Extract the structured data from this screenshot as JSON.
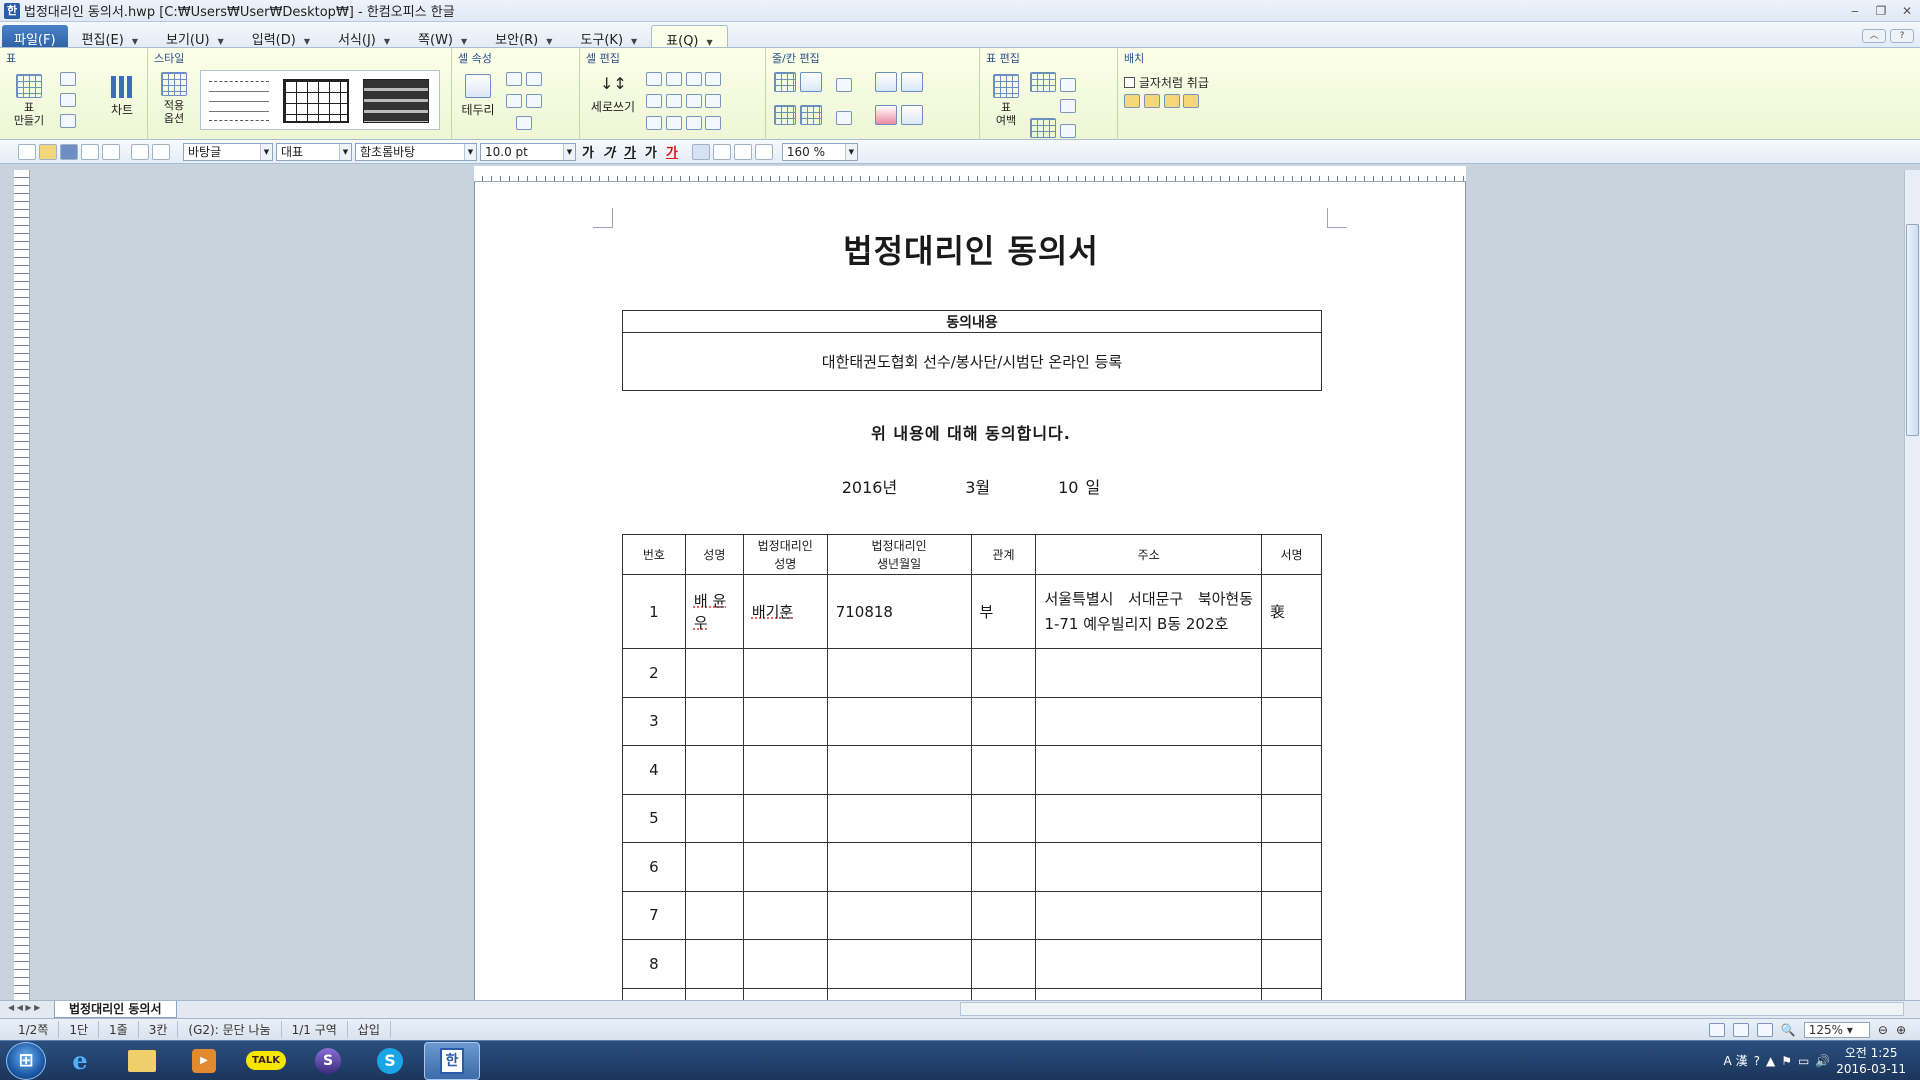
{
  "window": {
    "title": "법정대리인 동의서.hwp [C:₩Users₩User₩Desktop₩] - 한컴오피스 한글",
    "app_icon": "hwp-icon"
  },
  "menu": {
    "file": "파일(F)",
    "items": [
      "편집(E)",
      "보기(U)",
      "입력(D)",
      "서식(J)",
      "쪽(W)",
      "보안(R)",
      "도구(K)",
      "표(Q)"
    ]
  },
  "ribbon": {
    "groups": {
      "table": "표",
      "style": "스타일",
      "cell_props": "셀 속성",
      "cell_edit": "셀 편집",
      "rowcol_edit": "줄/칸 편집",
      "table_edit": "표 편집",
      "layout": "배치"
    },
    "labels": {
      "make_table": "표\n만들기",
      "chart": "차트",
      "apply_options": "적용\n옵션",
      "borders": "테두리",
      "vertical_write": "세로쓰기",
      "table_margin": "표\n여백",
      "treat_as_char": "글자처럼 취급"
    }
  },
  "toolbar": {
    "style_combo": "바탕글",
    "lang_combo": "대표",
    "font_combo": "함초롬바탕",
    "size_combo": "10.0",
    "size_unit": "pt",
    "bold": "가",
    "italic": "가",
    "underline": "가",
    "strike": "가",
    "color": "가",
    "line_spacing": "160",
    "line_spacing_unit": "%"
  },
  "document": {
    "title": "법정대리인 동의서",
    "consent_header": "동의내용",
    "consent_body": "대한태권도협회 선수/봉사단/시범단 온라인 등록",
    "agree_text": "위 내용에 대해 동의합니다.",
    "date": {
      "year": "2016년",
      "month": "3월",
      "day": "10 일"
    },
    "table": {
      "headers": [
        "번호",
        "성명",
        "법정대리인\n성명",
        "법정대리인\n생년월일",
        "관계",
        "주소",
        "서명"
      ],
      "rows": [
        [
          "1",
          "배 윤 우",
          "배기훈",
          "710818",
          "부",
          "서울특별시 서대문구 북아현동 1-71 예우빌리지 B동 202호",
          "裵"
        ],
        [
          "2",
          "",
          "",
          "",
          "",
          "",
          ""
        ],
        [
          "3",
          "",
          "",
          "",
          "",
          "",
          ""
        ],
        [
          "4",
          "",
          "",
          "",
          "",
          "",
          ""
        ],
        [
          "5",
          "",
          "",
          "",
          "",
          "",
          ""
        ],
        [
          "6",
          "",
          "",
          "",
          "",
          "",
          ""
        ],
        [
          "7",
          "",
          "",
          "",
          "",
          "",
          ""
        ],
        [
          "8",
          "",
          "",
          "",
          "",
          "",
          ""
        ]
      ]
    }
  },
  "doc_tab": "법정대리인 동의서",
  "status": {
    "page": "1/2쪽",
    "column": "1단",
    "line": "1줄",
    "col": "3칸",
    "cell": "(G2): 문단 나눔",
    "section": "1/1 구역",
    "mode": "삽입",
    "zoom": "125%"
  },
  "taskbar": {
    "apps": [
      "ie-icon",
      "explorer-icon",
      "media-player-icon",
      "kakaotalk-icon",
      "s-app-icon",
      "skype-icon",
      "hwp-icon"
    ],
    "kakao_label": "TALK",
    "clock_time": "오전 1:25",
    "clock_date": "2016-03-11",
    "ime": "A 漢"
  },
  "colors": {
    "ribbon_bg": "#eef6d6",
    "file_tab": "#2f63a8",
    "taskbar": "#1b355c"
  }
}
